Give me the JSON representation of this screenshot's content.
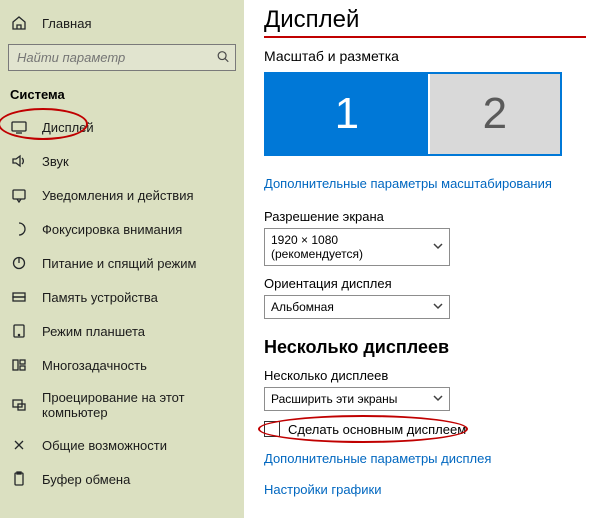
{
  "sidebar": {
    "home": "Главная",
    "search_placeholder": "Найти параметр",
    "section": "Система",
    "items": [
      {
        "label": "Дисплей",
        "icon": "display"
      },
      {
        "label": "Звук",
        "icon": "sound"
      },
      {
        "label": "Уведомления и действия",
        "icon": "notifications"
      },
      {
        "label": "Фокусировка внимания",
        "icon": "focus"
      },
      {
        "label": "Питание и спящий режим",
        "icon": "power"
      },
      {
        "label": "Память устройства",
        "icon": "storage"
      },
      {
        "label": "Режим планшета",
        "icon": "tablet"
      },
      {
        "label": "Многозадачность",
        "icon": "multitask"
      },
      {
        "label": "Проецирование на этот компьютер",
        "icon": "project"
      },
      {
        "label": "Общие возможности",
        "icon": "shared"
      },
      {
        "label": "Буфер обмена",
        "icon": "clipboard"
      }
    ]
  },
  "main": {
    "title": "Дисплей",
    "scale_head": "Масштаб и разметка",
    "monitor1": "1",
    "monitor2": "2",
    "adv_scale_link": "Дополнительные параметры масштабирования",
    "resolution_label": "Разрешение экрана",
    "resolution_value": "1920 × 1080 (рекомендуется)",
    "orientation_label": "Ориентация дисплея",
    "orientation_value": "Альбомная",
    "multi_head": "Несколько дисплеев",
    "multi_label": "Несколько дисплеев",
    "multi_value": "Расширить эти экраны",
    "make_primary": "Сделать основным дисплеем",
    "adv_display_link": "Дополнительные параметры дисплея",
    "graphics_link": "Настройки графики"
  }
}
